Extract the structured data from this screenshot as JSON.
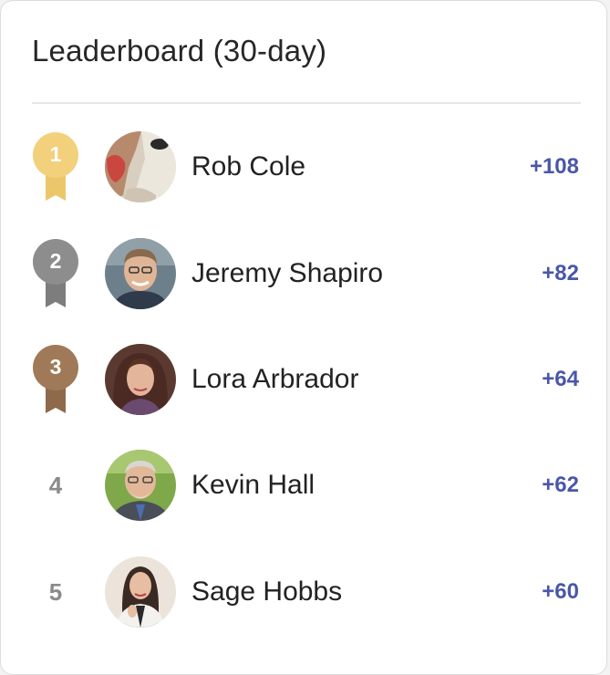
{
  "leaderboard": {
    "title": "Leaderboard (30-day)",
    "entries": [
      {
        "rank": "1",
        "name": "Rob Cole",
        "points": "+108",
        "medal": "gold",
        "medal_color": "#f2d07c"
      },
      {
        "rank": "2",
        "name": "Jeremy Shapiro",
        "points": "+82",
        "medal": "silver",
        "medal_color": "#8d8d8d"
      },
      {
        "rank": "3",
        "name": "Lora Arbrador",
        "points": "+64",
        "medal": "bronze",
        "medal_color": "#a07a58"
      },
      {
        "rank": "4",
        "name": "Kevin Hall",
        "points": "+62",
        "medal": "none"
      },
      {
        "rank": "5",
        "name": "Sage Hobbs",
        "points": "+60",
        "medal": "none"
      }
    ]
  },
  "colors": {
    "points_text": "#4a57a8",
    "title_text": "#262626",
    "divider": "#e6e6e6"
  }
}
